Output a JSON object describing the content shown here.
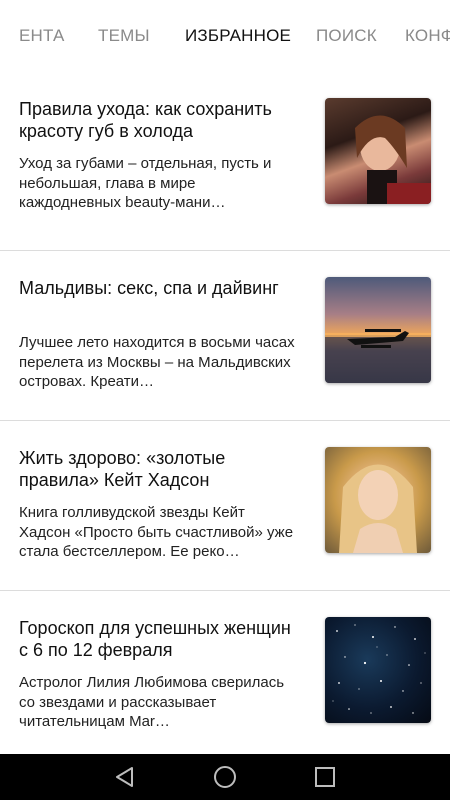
{
  "tabs": [
    {
      "label": "ЕНТА",
      "active": false
    },
    {
      "label": "ТЕМЫ",
      "active": false
    },
    {
      "label": "ИЗБРАННОЕ",
      "active": true
    },
    {
      "label": "ПОИСК",
      "active": false
    },
    {
      "label": "КОНФ",
      "active": false
    }
  ],
  "articles": [
    {
      "title": "Правила ухода: как сохранить красоту губ в холода",
      "snippet": "Уход за губами – отдельная, пусть и небольшая, глава в мире каждодневных beauty-мани…",
      "thumb_icon": "woman-portrait-image"
    },
    {
      "title": "Мальдивы: секс, спа и дайвинг",
      "snippet": "Лучшее лето находится в восьми часах перелета из Москвы – на Мальдивских островах. Креати…",
      "thumb_icon": "seaplane-sunset-image"
    },
    {
      "title": "Жить здорово: «золотые правила» Кейт Хадсон",
      "snippet": "Книга голливудской звезды Кейт Хадсон «Просто быть счастливой» уже стала бестселлером. Ее реко…",
      "thumb_icon": "blonde-woman-portrait-image"
    },
    {
      "title": "Гороскоп для успешных женщин с 6 по 12 февраля",
      "snippet": "Астролог Лилия Любимова сверилась со звездами и рассказывает читательницам Mar…",
      "thumb_icon": "starry-sky-image"
    }
  ],
  "navbar": {
    "icons": [
      "back-triangle-icon",
      "home-circle-icon",
      "recent-apps-square-icon"
    ]
  },
  "colors": {
    "active_tab": "#111111",
    "inactive_tab": "#8a8a8a",
    "divider": "#dcdcdc",
    "navbar": "#000000"
  }
}
